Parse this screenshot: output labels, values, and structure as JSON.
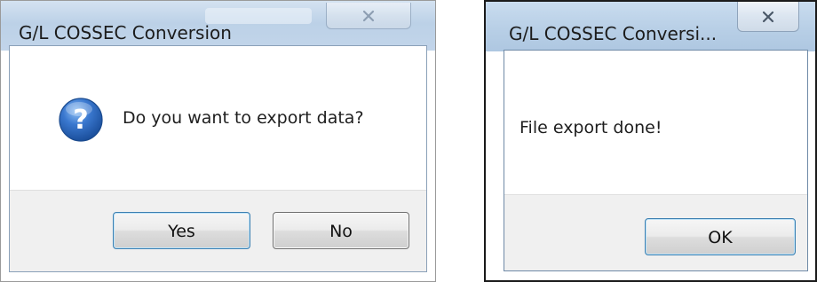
{
  "dialogs": [
    {
      "title": "G/L COSSEC Conversion",
      "message": "Do you want to export data?",
      "icon": "question-icon",
      "buttons": {
        "yes_label": "Yes",
        "no_label": "No"
      }
    },
    {
      "title": "G/L COSSEC Conversi...",
      "message": "File export done!",
      "buttons": {
        "ok_label": "OK"
      }
    }
  ],
  "colors": {
    "titlebar": "#bcd1e7",
    "button_area": "#f0f0f0",
    "icon_blue": "#2a63b8"
  }
}
